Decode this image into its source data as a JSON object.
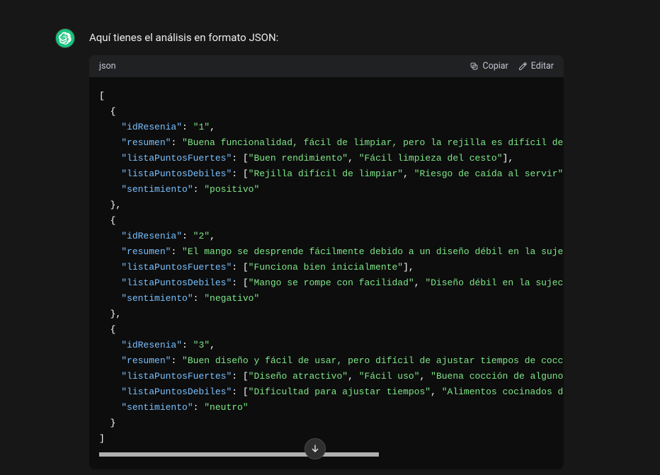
{
  "intro": "Aquí tienes el análisis en formato JSON:",
  "code": {
    "lang": "json",
    "actions": {
      "copy": "Copiar",
      "edit": "Editar"
    }
  },
  "json_items": [
    {
      "idResenia": "1",
      "resumen": "Buena funcionalidad, fácil de limpiar, pero la rejilla es difícil de asear",
      "listaPuntosFuertes": [
        "Buen rendimiento",
        "Fácil limpieza del cesto"
      ],
      "listaPuntosDebiles": [
        "Rejilla difícil de limpiar",
        "Riesgo de caída al servir"
      ],
      "sentimiento": "positivo"
    },
    {
      "idResenia": "2",
      "resumen": "El mango se desprende fácilmente debido a un diseño débil en la sujeción c",
      "listaPuntosFuertes": [
        "Funciona bien inicialmente"
      ],
      "listaPuntosDebiles": [
        "Mango se rompe con facilidad",
        "Diseño débil en la sujeción"
      ],
      "sentimiento": "negativo"
    },
    {
      "idResenia": "3",
      "resumen": "Buen diseño y fácil de usar, pero difícil de ajustar tiempos de cocción. C",
      "listaPuntosFuertes": [
        "Diseño atractivo",
        "Fácil uso",
        "Buena cocción de algunos alim"
      ],
      "listaPuntosDebiles": [
        "Dificultad para ajustar tiempos",
        "Alimentos cocinados de form"
      ],
      "sentimiento": "neutro"
    }
  ]
}
